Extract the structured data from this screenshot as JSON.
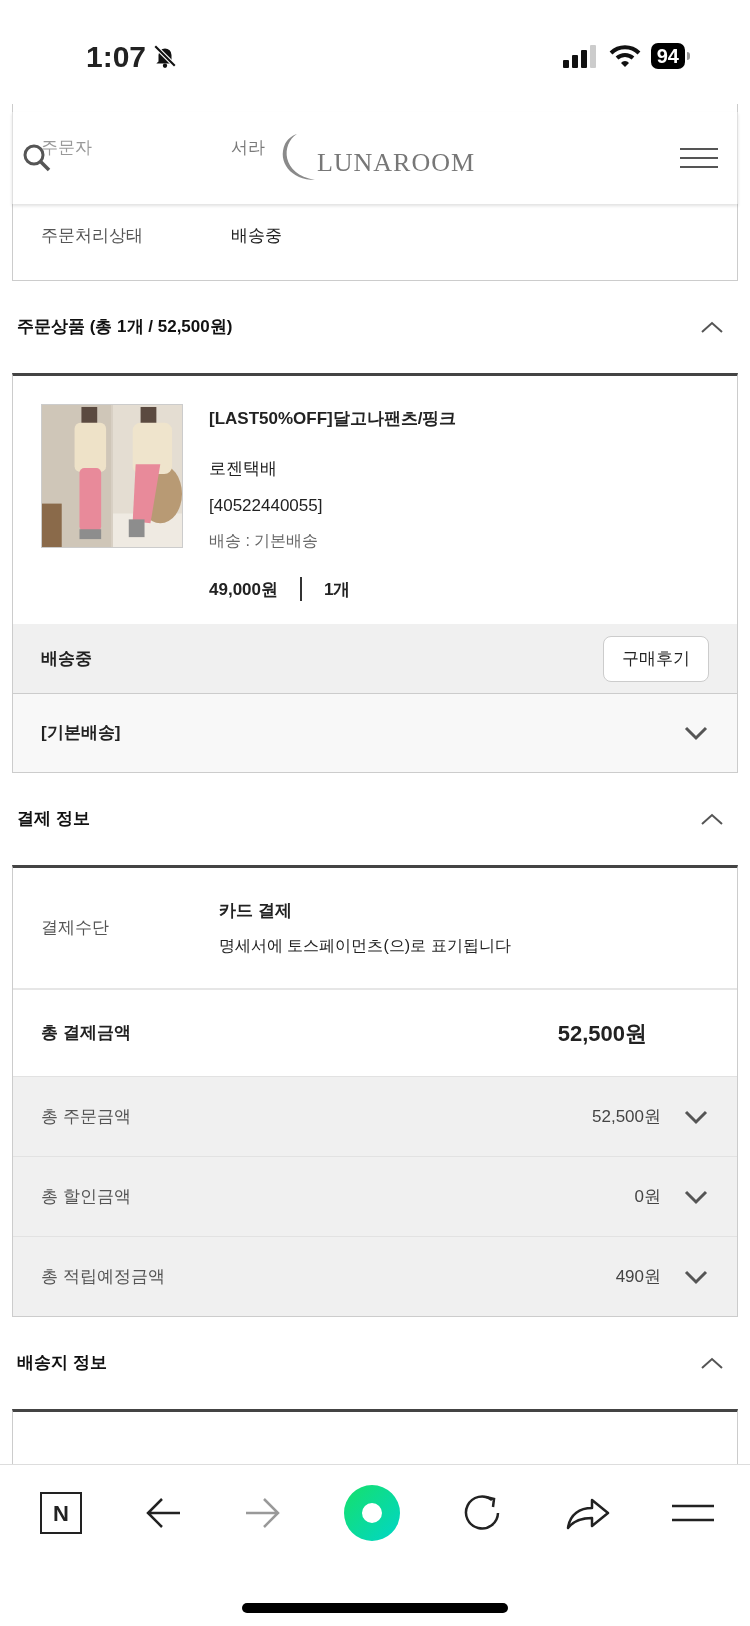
{
  "status_bar": {
    "time": "1:07",
    "battery": "94"
  },
  "header": {
    "logo": "LUNAROOM"
  },
  "order_info": {
    "rows": [
      {
        "label": "주문자",
        "value": "서라"
      },
      {
        "label": "주문처리상태",
        "value": "배송중"
      }
    ]
  },
  "products_section": {
    "title": "주문상품 (총 1개 / 52,500원)",
    "expanded": true,
    "product": {
      "name": "[LAST50%OFF]달고나팬츠/핑크",
      "carrier": "로젠택배",
      "tracking": "[40522440055]",
      "shipping": "배송 : 기본배송",
      "price": "49,000원",
      "quantity": "1개"
    },
    "status": "배송중",
    "review_button": "구매후기",
    "shipping_group": {
      "label": "[기본배송]",
      "expanded": false
    }
  },
  "payment_section": {
    "title": "결제 정보",
    "expanded": true,
    "method_label": "결제수단",
    "method": "카드 결제",
    "method_note": "명세서에 토스페이먼츠(으)로 표기됩니다",
    "total_label": "총 결제금액",
    "total": "52,500원",
    "breakdown": [
      {
        "label": "총 주문금액",
        "value": "52,500원",
        "expanded": false
      },
      {
        "label": "총 할인금액",
        "value": "0원",
        "expanded": false
      },
      {
        "label": "총 적립예정금액",
        "value": "490원",
        "expanded": false
      }
    ]
  },
  "address_section": {
    "title": "배송지 정보",
    "expanded": true
  },
  "toolbar": {
    "n_key": "N",
    "forward_disabled": true
  }
}
